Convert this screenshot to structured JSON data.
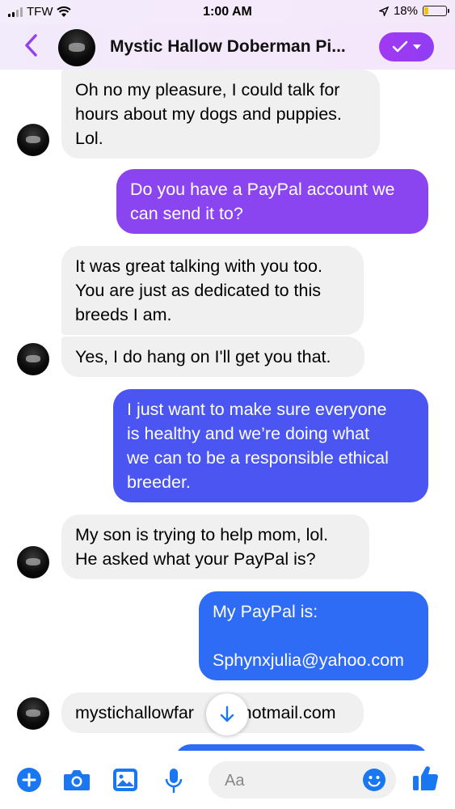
{
  "status_bar": {
    "carrier": "TFW",
    "time": "1:00 AM",
    "battery": "18%",
    "battery_level": 0.18
  },
  "header": {
    "title": "Mystic Hallow Doberman Pi..."
  },
  "messages": [
    {
      "dir": "in",
      "text": "Oh no my pleasure, I could talk for\nhours about my dogs and puppies.\nLol."
    },
    {
      "dir": "out",
      "text": "Do you have a PayPal account we\ncan send it to?",
      "color": "#8b45f0"
    },
    {
      "dir": "in",
      "text": "It was great talking with you too.\nYou are just as dedicated to this\nbreeds I am."
    },
    {
      "dir": "in",
      "text": "Yes, I do hang on I'll get you that."
    },
    {
      "dir": "out",
      "text": "I just want to make sure everyone\nis healthy and we’re doing what\nwe can to be a responsible ethical\nbreeder.",
      "color": "#4a55f2"
    },
    {
      "dir": "in",
      "text": "My son is trying to help mom, lol.\nHe asked what your PayPal is?"
    },
    {
      "dir": "out",
      "text": "My PayPal is:\n\nSphynxjulia@yahoo.com",
      "color": "#2f6cf5"
    },
    {
      "dir": "in",
      "text": "mystichallowfar          hotmail.com"
    }
  ],
  "composer": {
    "placeholder": "Aa"
  },
  "colors": {
    "accent": "#8e3ef4",
    "icon_blue": "#1a77f2"
  }
}
